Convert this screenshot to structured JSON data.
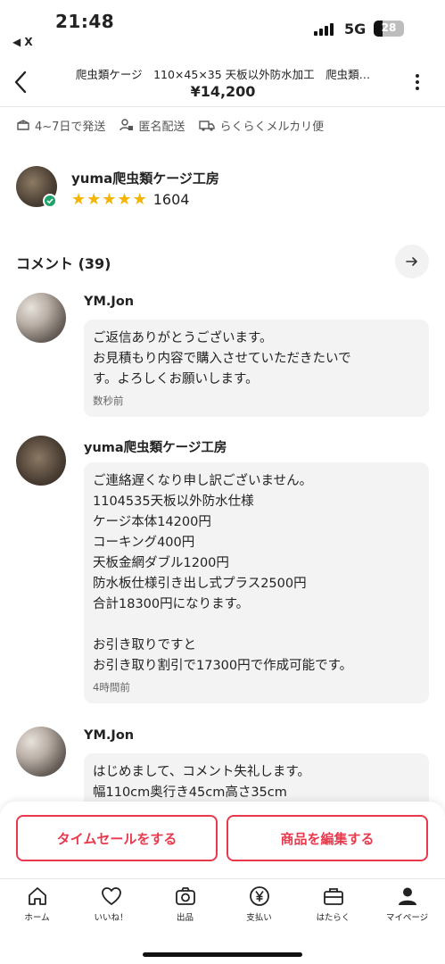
{
  "status_bar": {
    "time": "21:48",
    "back_app": "◀ X",
    "network": "5G",
    "battery": "28"
  },
  "header": {
    "title": "爬虫類ケージ　110×45×35 天板以外防水加工　爬虫類…",
    "price": "¥14,200",
    "back_icon": "chevron-left-icon",
    "more_icon": "vertical-dots-icon"
  },
  "shipping": {
    "items": [
      {
        "icon": "package-icon",
        "label": "4~7日で発送"
      },
      {
        "icon": "anonymous-user-icon",
        "label": "匿名配送"
      },
      {
        "icon": "truck-icon",
        "label": "らくらくメルカリ便"
      }
    ]
  },
  "seller": {
    "name": "yuma爬虫類ケージ工房",
    "rating_stars": 5,
    "rating_count": "1604"
  },
  "comments_section": {
    "title": "コメント (39)",
    "arrow_icon": "arrow-right-icon"
  },
  "comments": [
    {
      "name": "YM.Jon",
      "lines": [
        "ご返信ありがとうございます。",
        "お見積もり内容で購入させていただきたいで",
        "す。よろしくお願いします。"
      ],
      "time": "数秒前"
    },
    {
      "name": "yuma爬虫類ケージ工房",
      "lines": [
        "ご連絡遅くなり申し訳ございません。",
        "1104535天板以外防水仕様",
        "ケージ本体14200円",
        "コーキング400円",
        "天板金網ダブル1200円",
        "防水板仕様引き出し式プラス2500円",
        "合計18300円になります。",
        "",
        "お引き取りですと",
        "お引き取り割引で17300円で作成可能です。"
      ],
      "time": "4時間前"
    },
    {
      "name": "YM.Jon",
      "lines": [
        "はじめまして、コメント失礼します。",
        "幅110cm奥行き45cm高さ35cm"
      ],
      "time": ""
    }
  ],
  "actions": {
    "timesale": "タイムセールをする",
    "edit": "商品を編集する"
  },
  "tabs": [
    {
      "icon": "home-icon",
      "label": "ホーム"
    },
    {
      "icon": "heart-icon",
      "label": "いいね！"
    },
    {
      "icon": "camera-icon",
      "label": "出品"
    },
    {
      "icon": "yen-icon",
      "label": "支払い"
    },
    {
      "icon": "briefcase-icon",
      "label": "はたらく"
    },
    {
      "icon": "user-icon",
      "label": "マイページ"
    }
  ],
  "colors": {
    "accent": "#e8394d",
    "star": "#f5b400",
    "verified": "#1fa36b"
  }
}
